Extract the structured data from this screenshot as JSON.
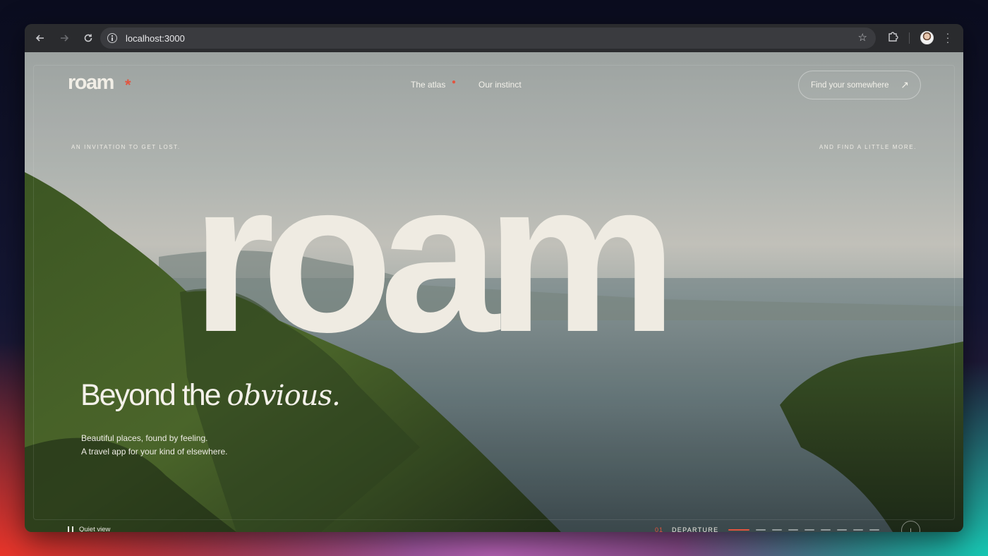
{
  "browser": {
    "url": "localhost:3000",
    "back_icon": "arrow-left-icon",
    "forward_icon": "arrow-right-icon",
    "reload_icon": "reload-icon"
  },
  "site": {
    "logo": "roam",
    "logo_mark": "*",
    "accent_color": "#e2543f",
    "nav": [
      "The atlas",
      "Our instinct"
    ],
    "cta_label": "Find your somewhere",
    "kicker_left": "AN INVITATION TO GET LOST.",
    "kicker_right": "AND FIND A LITTLE MORE.",
    "hero_word": "roam",
    "headline_start": "Beyond the ",
    "headline_em": "obvious.",
    "subline_1": "Beautiful places, found by feeling.",
    "subline_2": "A travel app for your kind of elsewhere.",
    "quiet_view": "Quiet view",
    "step_number": "01",
    "step_label": "DEPARTURE",
    "step_count": 9,
    "active_step": 1
  }
}
